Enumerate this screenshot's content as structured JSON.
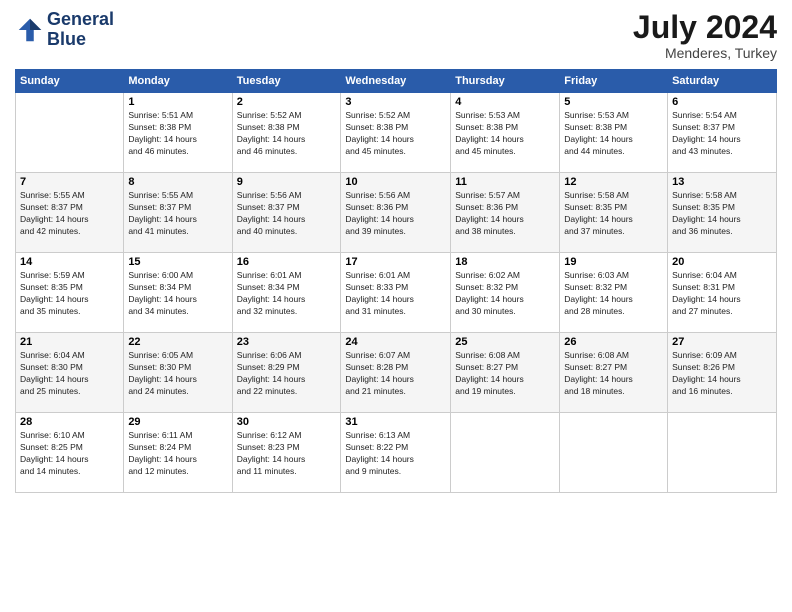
{
  "logo": {
    "line1": "General",
    "line2": "Blue"
  },
  "title": {
    "month_year": "July 2024",
    "location": "Menderes, Turkey"
  },
  "days_of_week": [
    "Sunday",
    "Monday",
    "Tuesday",
    "Wednesday",
    "Thursday",
    "Friday",
    "Saturday"
  ],
  "weeks": [
    [
      {
        "day": "",
        "info": ""
      },
      {
        "day": "1",
        "info": "Sunrise: 5:51 AM\nSunset: 8:38 PM\nDaylight: 14 hours\nand 46 minutes."
      },
      {
        "day": "2",
        "info": "Sunrise: 5:52 AM\nSunset: 8:38 PM\nDaylight: 14 hours\nand 46 minutes."
      },
      {
        "day": "3",
        "info": "Sunrise: 5:52 AM\nSunset: 8:38 PM\nDaylight: 14 hours\nand 45 minutes."
      },
      {
        "day": "4",
        "info": "Sunrise: 5:53 AM\nSunset: 8:38 PM\nDaylight: 14 hours\nand 45 minutes."
      },
      {
        "day": "5",
        "info": "Sunrise: 5:53 AM\nSunset: 8:38 PM\nDaylight: 14 hours\nand 44 minutes."
      },
      {
        "day": "6",
        "info": "Sunrise: 5:54 AM\nSunset: 8:37 PM\nDaylight: 14 hours\nand 43 minutes."
      }
    ],
    [
      {
        "day": "7",
        "info": "Sunrise: 5:55 AM\nSunset: 8:37 PM\nDaylight: 14 hours\nand 42 minutes."
      },
      {
        "day": "8",
        "info": "Sunrise: 5:55 AM\nSunset: 8:37 PM\nDaylight: 14 hours\nand 41 minutes."
      },
      {
        "day": "9",
        "info": "Sunrise: 5:56 AM\nSunset: 8:37 PM\nDaylight: 14 hours\nand 40 minutes."
      },
      {
        "day": "10",
        "info": "Sunrise: 5:56 AM\nSunset: 8:36 PM\nDaylight: 14 hours\nand 39 minutes."
      },
      {
        "day": "11",
        "info": "Sunrise: 5:57 AM\nSunset: 8:36 PM\nDaylight: 14 hours\nand 38 minutes."
      },
      {
        "day": "12",
        "info": "Sunrise: 5:58 AM\nSunset: 8:35 PM\nDaylight: 14 hours\nand 37 minutes."
      },
      {
        "day": "13",
        "info": "Sunrise: 5:58 AM\nSunset: 8:35 PM\nDaylight: 14 hours\nand 36 minutes."
      }
    ],
    [
      {
        "day": "14",
        "info": "Sunrise: 5:59 AM\nSunset: 8:35 PM\nDaylight: 14 hours\nand 35 minutes."
      },
      {
        "day": "15",
        "info": "Sunrise: 6:00 AM\nSunset: 8:34 PM\nDaylight: 14 hours\nand 34 minutes."
      },
      {
        "day": "16",
        "info": "Sunrise: 6:01 AM\nSunset: 8:34 PM\nDaylight: 14 hours\nand 32 minutes."
      },
      {
        "day": "17",
        "info": "Sunrise: 6:01 AM\nSunset: 8:33 PM\nDaylight: 14 hours\nand 31 minutes."
      },
      {
        "day": "18",
        "info": "Sunrise: 6:02 AM\nSunset: 8:32 PM\nDaylight: 14 hours\nand 30 minutes."
      },
      {
        "day": "19",
        "info": "Sunrise: 6:03 AM\nSunset: 8:32 PM\nDaylight: 14 hours\nand 28 minutes."
      },
      {
        "day": "20",
        "info": "Sunrise: 6:04 AM\nSunset: 8:31 PM\nDaylight: 14 hours\nand 27 minutes."
      }
    ],
    [
      {
        "day": "21",
        "info": "Sunrise: 6:04 AM\nSunset: 8:30 PM\nDaylight: 14 hours\nand 25 minutes."
      },
      {
        "day": "22",
        "info": "Sunrise: 6:05 AM\nSunset: 8:30 PM\nDaylight: 14 hours\nand 24 minutes."
      },
      {
        "day": "23",
        "info": "Sunrise: 6:06 AM\nSunset: 8:29 PM\nDaylight: 14 hours\nand 22 minutes."
      },
      {
        "day": "24",
        "info": "Sunrise: 6:07 AM\nSunset: 8:28 PM\nDaylight: 14 hours\nand 21 minutes."
      },
      {
        "day": "25",
        "info": "Sunrise: 6:08 AM\nSunset: 8:27 PM\nDaylight: 14 hours\nand 19 minutes."
      },
      {
        "day": "26",
        "info": "Sunrise: 6:08 AM\nSunset: 8:27 PM\nDaylight: 14 hours\nand 18 minutes."
      },
      {
        "day": "27",
        "info": "Sunrise: 6:09 AM\nSunset: 8:26 PM\nDaylight: 14 hours\nand 16 minutes."
      }
    ],
    [
      {
        "day": "28",
        "info": "Sunrise: 6:10 AM\nSunset: 8:25 PM\nDaylight: 14 hours\nand 14 minutes."
      },
      {
        "day": "29",
        "info": "Sunrise: 6:11 AM\nSunset: 8:24 PM\nDaylight: 14 hours\nand 12 minutes."
      },
      {
        "day": "30",
        "info": "Sunrise: 6:12 AM\nSunset: 8:23 PM\nDaylight: 14 hours\nand 11 minutes."
      },
      {
        "day": "31",
        "info": "Sunrise: 6:13 AM\nSunset: 8:22 PM\nDaylight: 14 hours\nand 9 minutes."
      },
      {
        "day": "",
        "info": ""
      },
      {
        "day": "",
        "info": ""
      },
      {
        "day": "",
        "info": ""
      }
    ]
  ]
}
